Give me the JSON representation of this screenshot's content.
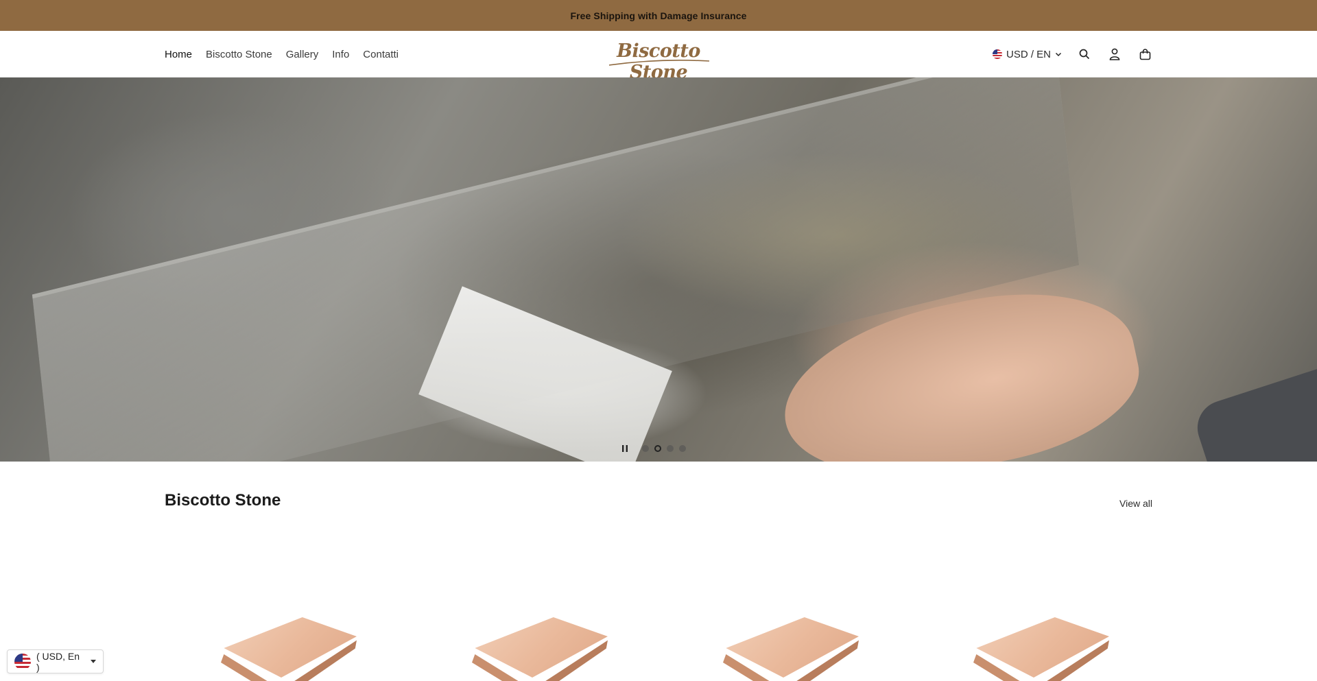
{
  "announcement": {
    "text": "Free Shipping with Damage Insurance"
  },
  "nav": {
    "items": [
      {
        "label": "Home"
      },
      {
        "label": "Biscotto Stone"
      },
      {
        "label": "Gallery"
      },
      {
        "label": "Info"
      },
      {
        "label": "Contatti"
      }
    ]
  },
  "brand": {
    "logo_text": "Biscotto Stone"
  },
  "header_tools": {
    "locale": "USD / EN"
  },
  "hero": {
    "slides_total": 4,
    "active_slide": 2
  },
  "collection": {
    "title": "Biscotto Stone",
    "view_all_label": "View all",
    "product_count_visible": 4
  },
  "currency_widget": {
    "label": "( USD, En )"
  },
  "colors": {
    "announcement_bg": "#8f6a41",
    "brand": "#8f6a41",
    "tile": "#e9b89a"
  },
  "icons": [
    "chevron-down-icon",
    "search-icon",
    "account-icon",
    "cart-icon",
    "pause-icon",
    "us-flag-icon",
    "caret-down-icon"
  ]
}
